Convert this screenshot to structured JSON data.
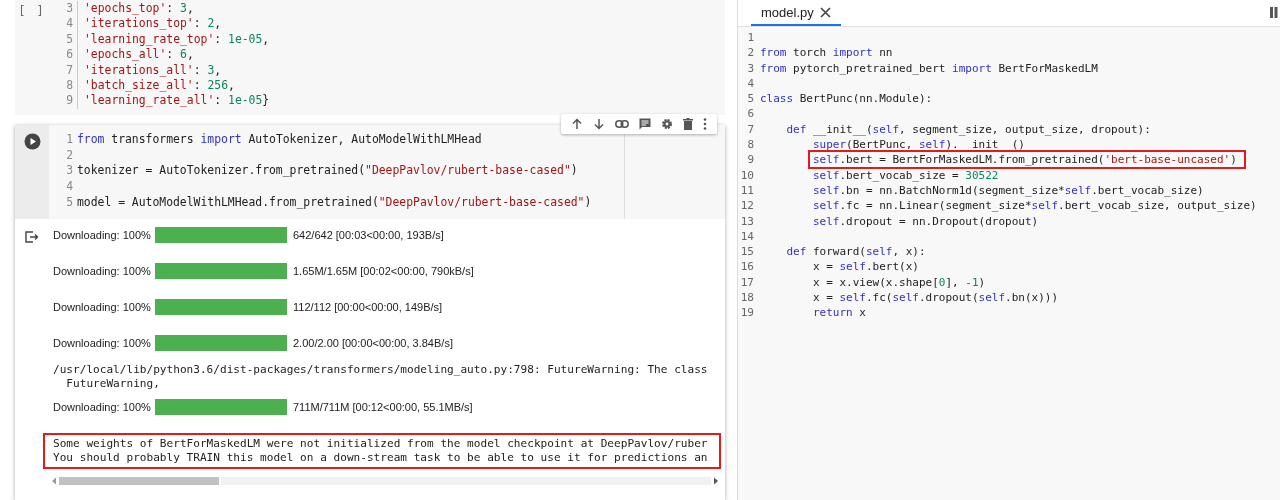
{
  "notebook": {
    "cells": [
      {
        "kind": "code",
        "prompt": "[ ]",
        "lines": [
          {
            "n": "3",
            "tokens": [
              {
                "kind": "str",
                "text": "'epochs_top'"
              },
              {
                "kind": "plain",
                "text": ": "
              },
              {
                "kind": "num",
                "text": "3"
              },
              {
                "kind": "plain",
                "text": ","
              }
            ]
          },
          {
            "n": "4",
            "tokens": [
              {
                "kind": "str",
                "text": "'iterations_top'"
              },
              {
                "kind": "plain",
                "text": ": "
              },
              {
                "kind": "num",
                "text": "2"
              },
              {
                "kind": "plain",
                "text": ","
              }
            ]
          },
          {
            "n": "5",
            "tokens": [
              {
                "kind": "str",
                "text": "'learning_rate_top'"
              },
              {
                "kind": "plain",
                "text": ": "
              },
              {
                "kind": "num",
                "text": "1e-05"
              },
              {
                "kind": "plain",
                "text": ","
              }
            ]
          },
          {
            "n": "6",
            "tokens": [
              {
                "kind": "str",
                "text": "'epochs_all'"
              },
              {
                "kind": "plain",
                "text": ": "
              },
              {
                "kind": "num",
                "text": "6"
              },
              {
                "kind": "plain",
                "text": ","
              }
            ]
          },
          {
            "n": "7",
            "tokens": [
              {
                "kind": "str",
                "text": "'iterations_all'"
              },
              {
                "kind": "plain",
                "text": ": "
              },
              {
                "kind": "num",
                "text": "3"
              },
              {
                "kind": "plain",
                "text": ","
              }
            ]
          },
          {
            "n": "8",
            "tokens": [
              {
                "kind": "str",
                "text": "'batch_size_all'"
              },
              {
                "kind": "plain",
                "text": ": "
              },
              {
                "kind": "num",
                "text": "256"
              },
              {
                "kind": "plain",
                "text": ","
              }
            ]
          },
          {
            "n": "9",
            "tokens": [
              {
                "kind": "str",
                "text": "'learning_rate_all'"
              },
              {
                "kind": "plain",
                "text": ": "
              },
              {
                "kind": "num",
                "text": "1e-05"
              },
              {
                "kind": "plain",
                "text": "}"
              }
            ]
          }
        ]
      },
      {
        "kind": "code",
        "run_button": true,
        "toolbar": true,
        "lines": [
          {
            "n": "1",
            "tokens": [
              {
                "kind": "kw",
                "text": "from"
              },
              {
                "kind": "plain",
                "text": " transformers "
              },
              {
                "kind": "kw",
                "text": "import"
              },
              {
                "kind": "plain",
                "text": " AutoTokenizer, AutoModelWithLMHead"
              }
            ]
          },
          {
            "n": "2"
          },
          {
            "n": "3",
            "tokens": [
              {
                "kind": "plain",
                "text": "tokenizer = AutoTokenizer.from_pretrained("
              },
              {
                "kind": "str",
                "text": "\"DeepPavlov/rubert-base-cased\""
              },
              {
                "kind": "plain",
                "text": ")"
              }
            ]
          },
          {
            "n": "4"
          },
          {
            "n": "5",
            "tokens": [
              {
                "kind": "plain",
                "text": "model = AutoModelWithLMHead.from_pretrained("
              },
              {
                "kind": "str",
                "text": "\"DeepPavlov/rubert-base-cased\""
              },
              {
                "kind": "plain",
                "text": ")"
              }
            ]
          }
        ],
        "outputs": [
          {
            "kind": "progress",
            "label": "Downloading: 100%",
            "level": 1,
            "reading": "642/642 [00:03<00:00, 193B/s]"
          },
          {
            "kind": "progress",
            "label": "Downloading: 100%",
            "level": 1,
            "reading": "1.65M/1.65M [00:02<00:00, 790kB/s]"
          },
          {
            "kind": "progress",
            "label": "Downloading: 100%",
            "level": 1,
            "reading": "112/112 [00:00<00:00, 149B/s]"
          },
          {
            "kind": "progress",
            "label": "Downloading: 100%",
            "level": 1,
            "reading": "2.00/2.00 [00:00<00:00, 3.84B/s]"
          },
          {
            "kind": "text",
            "lines": [
              "/usr/local/lib/python3.6/dist-packages/transformers/modeling_auto.py:798: FutureWarning: The class",
              "  FutureWarning,"
            ]
          },
          {
            "kind": "progress",
            "label": "Downloading: 100%",
            "level": 1,
            "reading": "711M/711M [00:12<00:00, 55.1MB/s]"
          },
          {
            "kind": "text",
            "highlighted": true,
            "lines": [
              "Some weights of BertForMaskedLM were not initialized from the model checkpoint at DeepPavlov/ruber",
              "You should probably TRAIN this model on a down-stream task to be able to use it for predictions an"
            ]
          }
        ]
      }
    ]
  },
  "editor": {
    "tabs": [
      {
        "label": "model.py",
        "selected": true
      }
    ],
    "lines": [
      {
        "n": "1"
      },
      {
        "n": "2",
        "tokens": [
          {
            "kind": "kw",
            "text": "from"
          },
          {
            "kind": "plain",
            "text": " torch "
          },
          {
            "kind": "kw",
            "text": "import"
          },
          {
            "kind": "plain",
            "text": " nn"
          }
        ]
      },
      {
        "n": "3",
        "tokens": [
          {
            "kind": "kw",
            "text": "from"
          },
          {
            "kind": "plain",
            "text": " pytorch_pretrained_bert "
          },
          {
            "kind": "kw",
            "text": "import"
          },
          {
            "kind": "plain",
            "text": " BertForMaskedLM"
          }
        ]
      },
      {
        "n": "4"
      },
      {
        "n": "5",
        "tokens": [
          {
            "kind": "kw",
            "text": "class"
          },
          {
            "kind": "plain",
            "text": " BertPunc(nn.Module):"
          }
        ]
      },
      {
        "n": "6"
      },
      {
        "n": "7",
        "tokens": [
          {
            "kind": "kw",
            "text": "    def"
          },
          {
            "kind": "plain",
            "text": " __init__("
          },
          {
            "kind": "self",
            "text": "self"
          },
          {
            "kind": "plain",
            "text": ", segment_size, output_size, dropout):"
          }
        ]
      },
      {
        "n": "8",
        "tokens": [
          {
            "kind": "self",
            "text": "        super"
          },
          {
            "kind": "plain",
            "text": "(BertPunc, "
          },
          {
            "kind": "self",
            "text": "self"
          },
          {
            "kind": "plain",
            "text": ").__init__()"
          }
        ]
      },
      {
        "n": "9",
        "highlighted": true,
        "tokens": [
          {
            "kind": "self",
            "text": "        self"
          },
          {
            "kind": "plain",
            "text": ".bert = BertForMaskedLM.from_pretrained("
          },
          {
            "kind": "str",
            "text": "'bert-base-uncased'"
          },
          {
            "kind": "plain",
            "text": ")"
          }
        ]
      },
      {
        "n": "10",
        "tokens": [
          {
            "kind": "self",
            "text": "        self"
          },
          {
            "kind": "plain",
            "text": ".bert_vocab_size = "
          },
          {
            "kind": "num",
            "text": "30522"
          }
        ]
      },
      {
        "n": "11",
        "tokens": [
          {
            "kind": "self",
            "text": "        self"
          },
          {
            "kind": "plain",
            "text": ".bn = nn.BatchNorm1d(segment_size*"
          },
          {
            "kind": "self",
            "text": "self"
          },
          {
            "kind": "plain",
            "text": ".bert_vocab_size)"
          }
        ]
      },
      {
        "n": "12",
        "tokens": [
          {
            "kind": "self",
            "text": "        self"
          },
          {
            "kind": "plain",
            "text": ".fc = nn.Linear(segment_size*"
          },
          {
            "kind": "self",
            "text": "self"
          },
          {
            "kind": "plain",
            "text": ".bert_vocab_size, output_size)"
          }
        ]
      },
      {
        "n": "13",
        "tokens": [
          {
            "kind": "self",
            "text": "        self"
          },
          {
            "kind": "plain",
            "text": ".dropout = nn.Dropout(dropout)"
          }
        ]
      },
      {
        "n": "14"
      },
      {
        "n": "15",
        "tokens": [
          {
            "kind": "kw",
            "text": "    def"
          },
          {
            "kind": "plain",
            "text": " forward("
          },
          {
            "kind": "self",
            "text": "self"
          },
          {
            "kind": "plain",
            "text": ", x):"
          }
        ]
      },
      {
        "n": "16",
        "tokens": [
          {
            "kind": "plain",
            "text": "        x = "
          },
          {
            "kind": "self",
            "text": "self"
          },
          {
            "kind": "plain",
            "text": ".bert(x)"
          }
        ]
      },
      {
        "n": "17",
        "tokens": [
          {
            "kind": "plain",
            "text": "        x = x.view(x.shape["
          },
          {
            "kind": "num",
            "text": "0"
          },
          {
            "kind": "plain",
            "text": "], "
          },
          {
            "kind": "num",
            "text": "-1"
          },
          {
            "kind": "plain",
            "text": ")"
          }
        ]
      },
      {
        "n": "18",
        "tokens": [
          {
            "kind": "plain",
            "text": "        x = "
          },
          {
            "kind": "self",
            "text": "self"
          },
          {
            "kind": "plain",
            "text": ".fc("
          },
          {
            "kind": "self",
            "text": "self"
          },
          {
            "kind": "plain",
            "text": ".dropout("
          },
          {
            "kind": "self",
            "text": "self"
          },
          {
            "kind": "plain",
            "text": ".bn(x)))"
          }
        ]
      },
      {
        "n": "19",
        "tokens": [
          {
            "kind": "kw",
            "text": "        return"
          },
          {
            "kind": "plain",
            "text": " x"
          }
        ]
      }
    ]
  }
}
